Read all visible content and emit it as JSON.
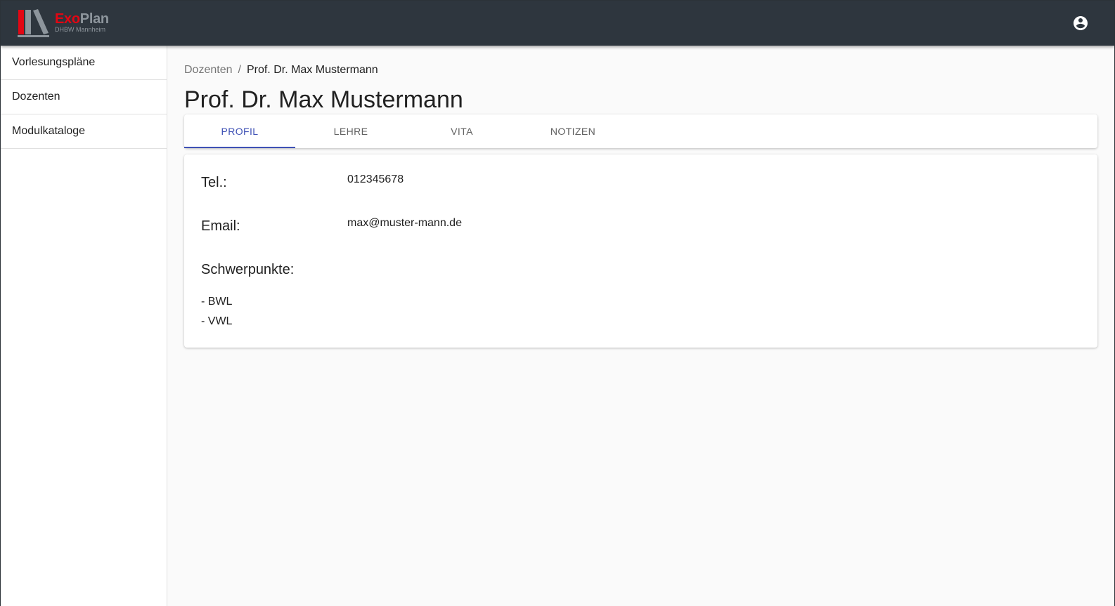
{
  "app": {
    "logo_part1": "Exo",
    "logo_part2": "Plan",
    "logo_sub": "DHBW Mannheim"
  },
  "header": {
    "account_icon": "account-circle-icon"
  },
  "sidebar": {
    "items": [
      {
        "label": "Vorlesungspläne"
      },
      {
        "label": "Dozenten"
      },
      {
        "label": "Modulkataloge"
      }
    ]
  },
  "breadcrumb": {
    "parent": "Dozenten",
    "separator": "/",
    "current": "Prof. Dr. Max Mustermann"
  },
  "page": {
    "title": "Prof. Dr. Max Mustermann"
  },
  "tabs": [
    {
      "label": "PROFIL",
      "active": true
    },
    {
      "label": "LEHRE",
      "active": false
    },
    {
      "label": "VITA",
      "active": false
    },
    {
      "label": "NOTIZEN",
      "active": false
    }
  ],
  "profile": {
    "tel_label": "Tel.:",
    "tel_value": "012345678",
    "email_label": "Email:",
    "email_value": "max@muster-mann.de",
    "focus_label": "Schwerpunkte:",
    "focus_items": [
      "- BWL",
      "- VWL"
    ]
  },
  "colors": {
    "appbar": "#2e363e",
    "accent": "#3f51b5",
    "logo_red": "#e30613",
    "logo_grey": "#8d959c"
  }
}
